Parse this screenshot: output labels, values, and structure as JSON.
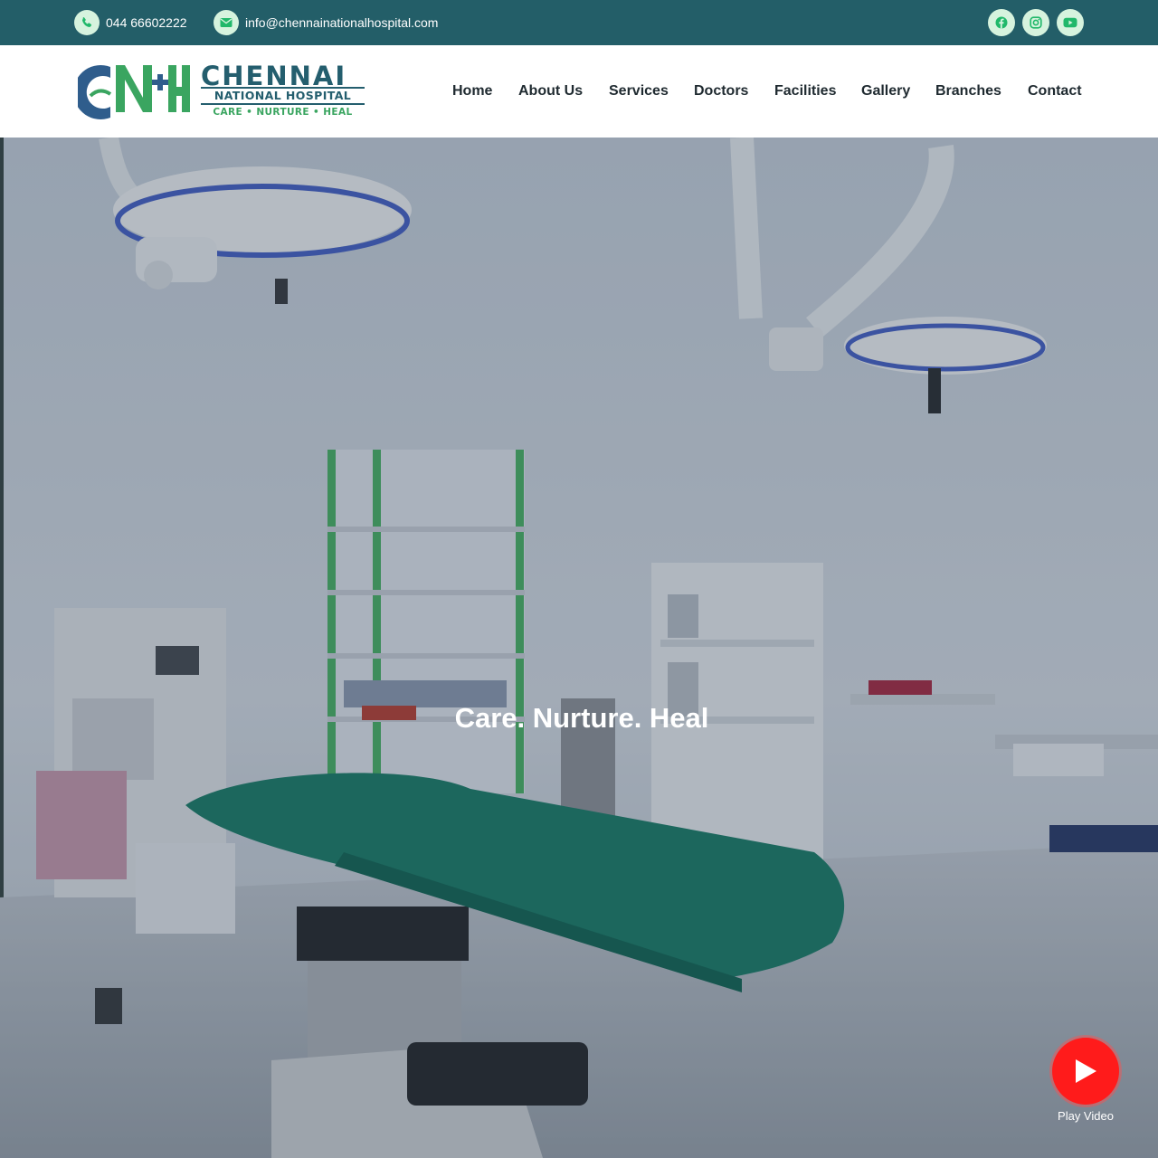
{
  "topbar": {
    "phone": "044 66602222",
    "email": "info@chennainationalhospital.com",
    "phone_icon": "phone-icon",
    "email_icon": "envelope-icon",
    "socials": [
      "facebook-icon",
      "instagram-icon",
      "youtube-icon"
    ]
  },
  "logo": {
    "title": "CHENNAI",
    "subtitle": "NATIONAL HOSPITAL",
    "tagline": "CARE • NURTURE • HEAL"
  },
  "nav": {
    "items": [
      "Home",
      "About Us",
      "Services",
      "Doctors",
      "Facilities",
      "Gallery",
      "Branches",
      "Contact"
    ]
  },
  "hero": {
    "heading": "Care. Nurture. Heal",
    "play_label": "Play Video"
  },
  "colors": {
    "topbar": "#235e68",
    "icon_circle": "#d6f3de",
    "icon_green": "#20b86a",
    "brand_blue": "#245e6e",
    "brand_green": "#3aa560",
    "play_red": "#ff1b1b"
  }
}
